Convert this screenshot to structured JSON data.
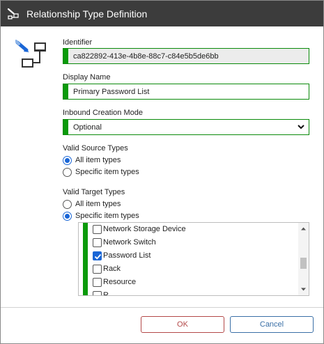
{
  "window": {
    "title": "Relationship Type Definition"
  },
  "identifier": {
    "label": "Identifier",
    "value": "ca822892-413e-4b8e-88c7-c84e5b5de6bb"
  },
  "display_name": {
    "label": "Display Name",
    "value": "Primary Password List"
  },
  "inbound_creation_mode": {
    "label": "Inbound Creation Mode",
    "selected": "Optional"
  },
  "valid_source_types": {
    "label": "Valid Source Types",
    "options": [
      {
        "label": "All item types",
        "selected": true
      },
      {
        "label": "Specific item types",
        "selected": false
      }
    ]
  },
  "valid_target_types": {
    "label": "Valid Target Types",
    "options": [
      {
        "label": "All item types",
        "selected": false
      },
      {
        "label": "Specific item types",
        "selected": true
      }
    ],
    "item_list": [
      {
        "label": "Network Storage Device",
        "checked": false
      },
      {
        "label": "Network Switch",
        "checked": false
      },
      {
        "label": "Password List",
        "checked": true
      },
      {
        "label": "Rack",
        "checked": false
      },
      {
        "label": "Resource",
        "checked": false
      },
      {
        "label": "R",
        "checked": false
      }
    ]
  },
  "buttons": {
    "ok": "OK",
    "cancel": "Cancel"
  },
  "colors": {
    "title_bar": "#3c3c3c",
    "required_bar": "#0a9a0a",
    "selection": "#1a66d6",
    "ok_border": "#b34848",
    "cancel_border": "#3a6fa6"
  },
  "icons": {
    "title": "relationship-edit-icon",
    "header": "relationship-diagram-icon"
  }
}
